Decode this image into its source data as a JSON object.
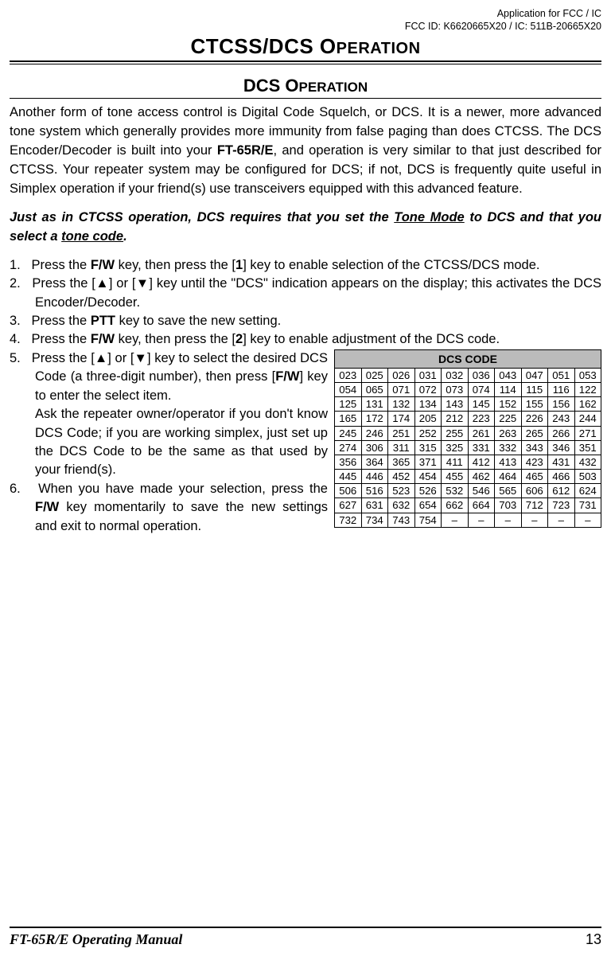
{
  "top": {
    "line1": "Application for FCC / IC",
    "line2": "FCC ID: K6620665X20 / IC: 511B-20665X20"
  },
  "main_title_1": "CTCSS/DCS O",
  "main_title_2": "PERATION",
  "section_title_1": "DCS O",
  "section_title_2": "PERATION",
  "paragraphs": {
    "intro_pre": "Another form of tone access control is Digital Code Squelch, or DCS. It is a newer, more advanced tone system which generally provides more immunity from false paging than does CTCSS. The DCS Encoder/Decoder is built into your ",
    "intro_bold": "FT-65R/E",
    "intro_post": ", and operation is very similar to that just described for CTCSS. Your repeater system may be configured for DCS; if not, DCS is frequently quite useful in Simplex operation if your friend(s) use transceivers equipped with this advanced feature.",
    "note_pre": "Just as in CTCSS operation, DCS requires that you set the ",
    "note_u1": "Tone Mode",
    "note_mid": " to DCS and that you select a ",
    "note_u2": "tone code",
    "note_post": "."
  },
  "steps": {
    "s1_num": "1.",
    "s1_a": "Press the ",
    "s1_b": "F/W",
    "s1_c": " key, then press the [",
    "s1_d": "1",
    "s1_e": "] key to enable selection of the CTCSS/DCS mode.",
    "s2_num": "2.",
    "s2_a": "Press the [",
    "s2_up": "▲",
    "s2_b": "] or [",
    "s2_dn": "▼",
    "s2_c": "] key until the \"DCS\" indication appears on the display; this activates the DCS Encoder/Decoder.",
    "s3_num": "3.",
    "s3_a": "Press the ",
    "s3_b": "PTT",
    "s3_c": " key to save the new setting.",
    "s4_num": "4.",
    "s4_a": "Press the ",
    "s4_b": "F/W",
    "s4_c": " key, then press the [",
    "s4_d": "2",
    "s4_e": "] key to enable adjustment of the DCS code.",
    "s5_num": "5.",
    "s5_a": "Press the [",
    "s5_up": "▲",
    "s5_b": "] or [",
    "s5_dn": "▼",
    "s5_c": "] key to select the desired DCS Code (a three-digit number), then press [",
    "s5_d": "F/W",
    "s5_e": "] key to enter the select item.",
    "s5_f": "Ask the repeater owner/operator if you don't know DCS Code; if you are working simplex, just set up the DCS Code to be the same as that used by your friend(s).",
    "s6_num": "6.",
    "s6_a": "When you have made your selection, press the ",
    "s6_b": "F/W",
    "s6_c": " key momentarily to save the new settings and exit to normal operation."
  },
  "table": {
    "header": "DCS CODE",
    "rows": [
      [
        "023",
        "025",
        "026",
        "031",
        "032",
        "036",
        "043",
        "047",
        "051",
        "053"
      ],
      [
        "054",
        "065",
        "071",
        "072",
        "073",
        "074",
        "114",
        "115",
        "116",
        "122"
      ],
      [
        "125",
        "131",
        "132",
        "134",
        "143",
        "145",
        "152",
        "155",
        "156",
        "162"
      ],
      [
        "165",
        "172",
        "174",
        "205",
        "212",
        "223",
        "225",
        "226",
        "243",
        "244"
      ],
      [
        "245",
        "246",
        "251",
        "252",
        "255",
        "261",
        "263",
        "265",
        "266",
        "271"
      ],
      [
        "274",
        "306",
        "311",
        "315",
        "325",
        "331",
        "332",
        "343",
        "346",
        "351"
      ],
      [
        "356",
        "364",
        "365",
        "371",
        "411",
        "412",
        "413",
        "423",
        "431",
        "432"
      ],
      [
        "445",
        "446",
        "452",
        "454",
        "455",
        "462",
        "464",
        "465",
        "466",
        "503"
      ],
      [
        "506",
        "516",
        "523",
        "526",
        "532",
        "546",
        "565",
        "606",
        "612",
        "624"
      ],
      [
        "627",
        "631",
        "632",
        "654",
        "662",
        "664",
        "703",
        "712",
        "723",
        "731"
      ],
      [
        "732",
        "734",
        "743",
        "754",
        "–",
        "–",
        "–",
        "–",
        "–",
        "–"
      ]
    ]
  },
  "footer": {
    "left": "FT-65R/E Operating Manual",
    "right": "13"
  },
  "chart_data": {
    "type": "table",
    "title": "DCS CODE",
    "rows": [
      [
        "023",
        "025",
        "026",
        "031",
        "032",
        "036",
        "043",
        "047",
        "051",
        "053"
      ],
      [
        "054",
        "065",
        "071",
        "072",
        "073",
        "074",
        "114",
        "115",
        "116",
        "122"
      ],
      [
        "125",
        "131",
        "132",
        "134",
        "143",
        "145",
        "152",
        "155",
        "156",
        "162"
      ],
      [
        "165",
        "172",
        "174",
        "205",
        "212",
        "223",
        "225",
        "226",
        "243",
        "244"
      ],
      [
        "245",
        "246",
        "251",
        "252",
        "255",
        "261",
        "263",
        "265",
        "266",
        "271"
      ],
      [
        "274",
        "306",
        "311",
        "315",
        "325",
        "331",
        "332",
        "343",
        "346",
        "351"
      ],
      [
        "356",
        "364",
        "365",
        "371",
        "411",
        "412",
        "413",
        "423",
        "431",
        "432"
      ],
      [
        "445",
        "446",
        "452",
        "454",
        "455",
        "462",
        "464",
        "465",
        "466",
        "503"
      ],
      [
        "506",
        "516",
        "523",
        "526",
        "532",
        "546",
        "565",
        "606",
        "612",
        "624"
      ],
      [
        "627",
        "631",
        "632",
        "654",
        "662",
        "664",
        "703",
        "712",
        "723",
        "731"
      ],
      [
        "732",
        "734",
        "743",
        "754",
        "–",
        "–",
        "–",
        "–",
        "–",
        "–"
      ]
    ]
  }
}
